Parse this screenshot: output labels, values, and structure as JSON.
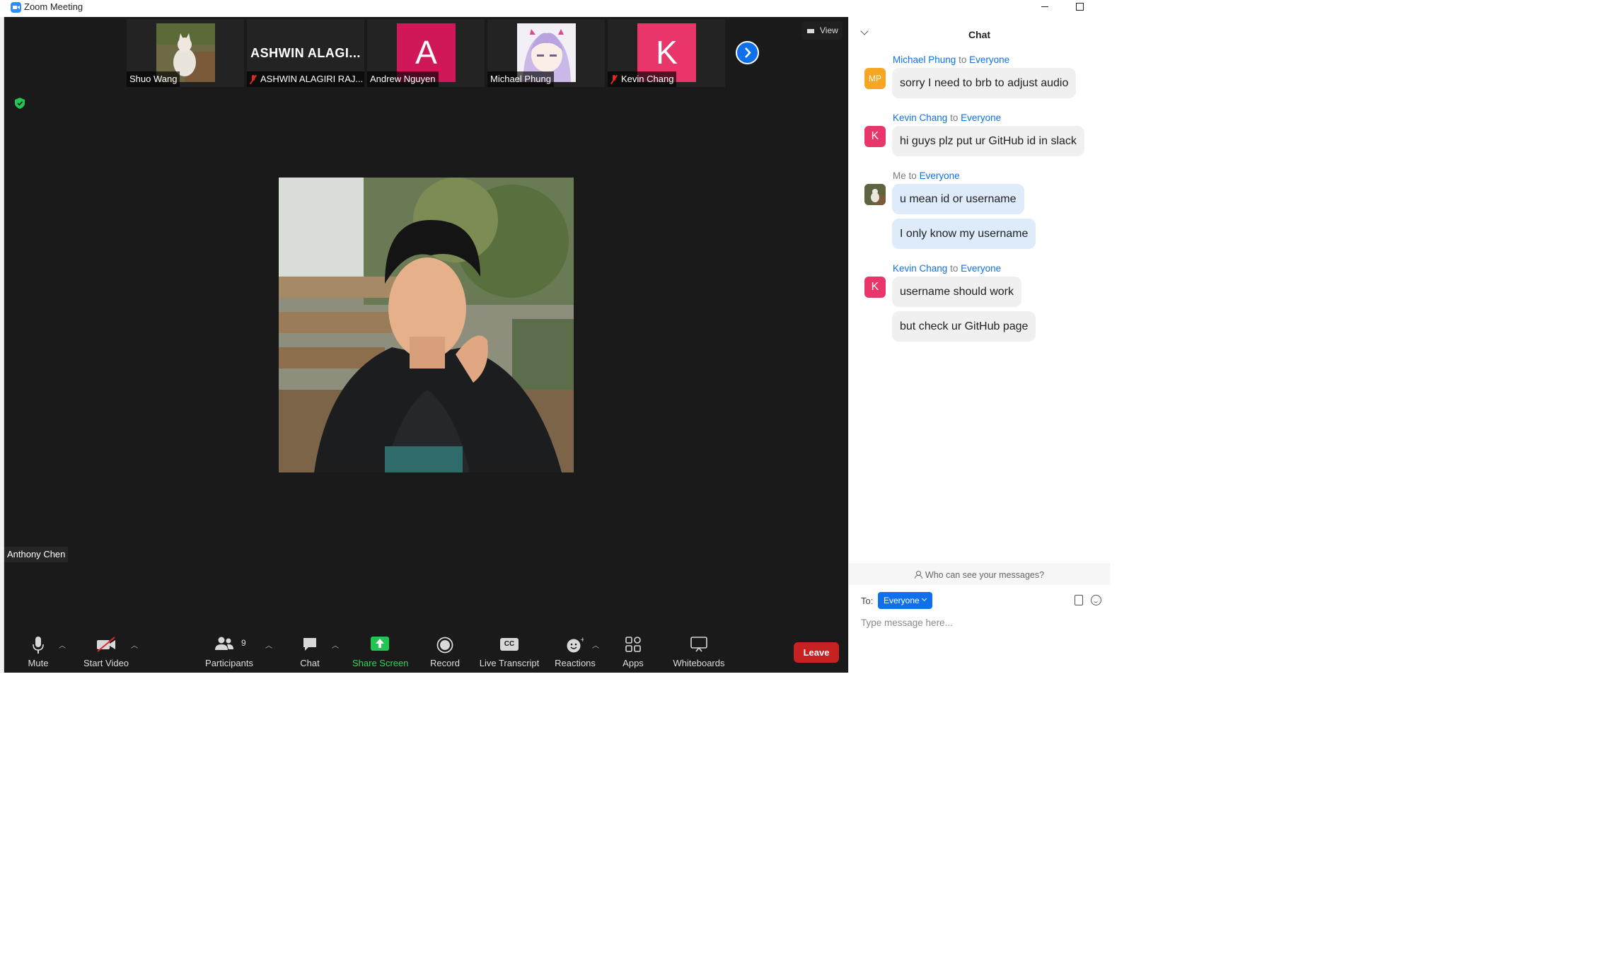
{
  "window": {
    "title": "Zoom Meeting"
  },
  "thumbnails": [
    {
      "name": "Shuo Wang",
      "muted": false,
      "kind": "photo"
    },
    {
      "name": "ASHWIN ALAGIRI RAJ...",
      "display": "ASHWIN  ALAGI...",
      "muted": true,
      "kind": "text"
    },
    {
      "name": "Andrew Nguyen",
      "muted": false,
      "kind": "letter",
      "letter": "A",
      "color": "#d0175a"
    },
    {
      "name": "Michael Phung",
      "muted": false,
      "kind": "anime"
    },
    {
      "name": "Kevin Chang",
      "muted": true,
      "kind": "letter",
      "letter": "K",
      "color": "#e8366b"
    }
  ],
  "view_button": {
    "label": "View"
  },
  "active_speaker": {
    "name": "Anthony Chen"
  },
  "toolbar": {
    "mute": "Mute",
    "start_video": "Start Video",
    "participants": "Participants",
    "participants_count": "9",
    "chat": "Chat",
    "share_screen": "Share Screen",
    "record": "Record",
    "live_transcript": "Live Transcript",
    "live_transcript_badge": "CC",
    "reactions": "Reactions",
    "apps": "Apps",
    "whiteboards": "Whiteboards",
    "leave": "Leave"
  },
  "chat": {
    "title": "Chat",
    "to_word": "to",
    "messages": [
      {
        "sender": "Michael Phung",
        "recipient": "Everyone",
        "avatar": "MP",
        "avatar_color": "#f5a623",
        "texts": [
          "sorry I need to brb to adjust audio"
        ]
      },
      {
        "sender": "Kevin Chang",
        "recipient": "Everyone",
        "avatar": "K",
        "avatar_color": "#e8366b",
        "texts": [
          "hi guys plz put ur GitHub id in slack"
        ]
      },
      {
        "sender": "Me",
        "recipient": "Everyone",
        "avatar": "",
        "avatar_color": "#6b6b55",
        "texts": [
          "u mean id or username",
          "I only know my username"
        ]
      },
      {
        "sender": "Kevin Chang",
        "recipient": "Everyone",
        "avatar": "K",
        "avatar_color": "#e8366b",
        "texts": [
          "username should work",
          "but check ur GitHub page"
        ]
      }
    ],
    "who_can_see": "Who can see your messages?",
    "to_label": "To:",
    "to_value": "Everyone",
    "input_placeholder": "Type message here..."
  },
  "colors": {
    "accent": "#0e71eb",
    "leave": "#c72121",
    "share": "#2dd65c",
    "meeting_bg": "#1a1a1a"
  }
}
